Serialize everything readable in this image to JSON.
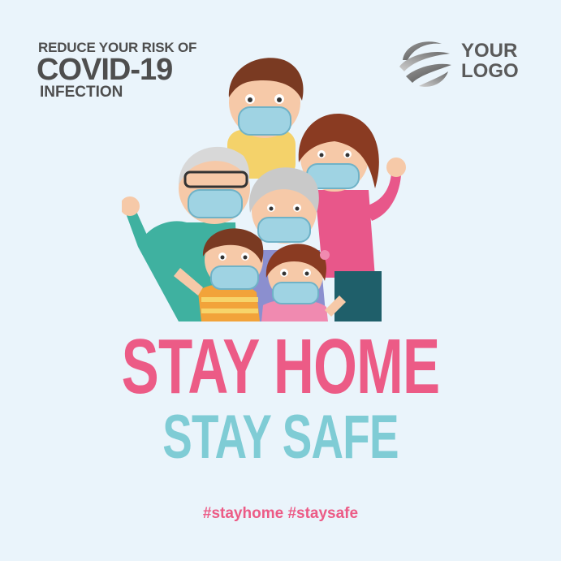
{
  "header": {
    "line1": "REDUCE YOUR RISK OF",
    "line2": "COVID-19",
    "line3": "INFECTION"
  },
  "logo": {
    "line1": "YOUR",
    "line2": "LOGO",
    "icon": "swirl-sphere-icon"
  },
  "illustration": {
    "icon": "family-wearing-masks-illustration"
  },
  "headline": {
    "line1": "STAY HOME",
    "line2": "STAY SAFE"
  },
  "hashtags": "#stayhome #staysafe",
  "colors": {
    "background": "#eaf4fb",
    "pink": "#ec5b86",
    "teal": "#7fccd5",
    "gray": "#4e4e4e"
  }
}
